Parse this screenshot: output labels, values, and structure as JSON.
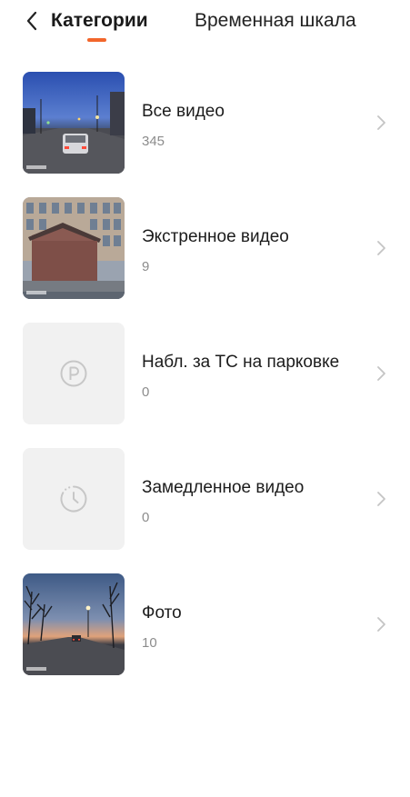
{
  "header": {
    "tabs": [
      {
        "label": "Категории",
        "active": true
      },
      {
        "label": "Временная шкала",
        "active": false
      }
    ],
    "back_icon": "back-arrow-icon"
  },
  "categories": [
    {
      "title": "Все видео",
      "count": "345",
      "thumbnail": "photo-night-street"
    },
    {
      "title": "Экстренное видео",
      "count": "9",
      "thumbnail": "photo-garage-building"
    },
    {
      "title": "Набл. за ТС на парковке",
      "count": "0",
      "thumbnail": "parking-icon"
    },
    {
      "title": "Замедленное видео",
      "count": "0",
      "thumbnail": "timelapse-icon"
    },
    {
      "title": "Фото",
      "count": "10",
      "thumbnail": "photo-dusk-road"
    }
  ],
  "colors": {
    "accent": "#f2662b",
    "placeholder_bg": "#f1f1f1",
    "secondary_text": "#8c8c8c",
    "chevron": "#c4c4c4"
  }
}
